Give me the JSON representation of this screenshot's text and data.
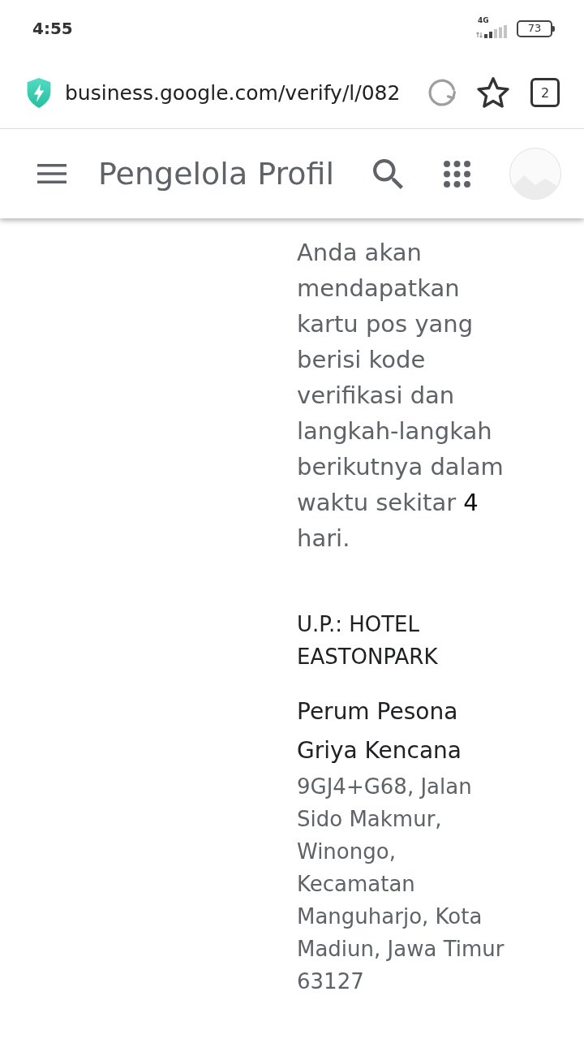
{
  "status_bar": {
    "time": "4:55",
    "network": "4G",
    "battery": "73"
  },
  "browser_bar": {
    "url": "business.google.com/verify/l/082",
    "tab_count": "2"
  },
  "app_bar": {
    "title": "Pengelola Profil"
  },
  "message": "Anda akan mendapatkan kartu pos yang berisi kode verifikasi dan langkah-langkah berikutnya dalam waktu sekitar **4** hari.",
  "recipient": "U.P.: HOTEL EASTONPARK",
  "business": {
    "name": "Perum Pesona Griya Kencana",
    "address": "9GJ4+G68, Jalan Sido Makmur, Winongo, Kecamatan Manguharjo, Kota Madiun, Jawa Timur 63127"
  }
}
